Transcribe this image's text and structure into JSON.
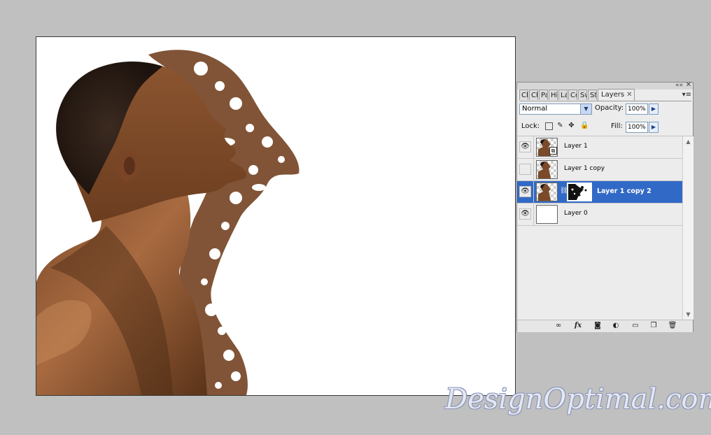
{
  "panel": {
    "tabs": [
      {
        "label": "Clo"
      },
      {
        "label": "Ch"
      },
      {
        "label": "Pa"
      },
      {
        "label": "His"
      },
      {
        "label": "La"
      },
      {
        "label": "Co"
      },
      {
        "label": "Sw"
      },
      {
        "label": "Sty"
      },
      {
        "label": "Layers",
        "active": true
      }
    ],
    "blend_mode": "Normal",
    "opacity_label": "Opacity:",
    "opacity_value": "100%",
    "lock_label": "Lock:",
    "fill_label": "Fill:",
    "fill_value": "100%",
    "layers": [
      {
        "name": "Layer 1",
        "visible": true,
        "selected": false,
        "smart_object": true,
        "mask": false
      },
      {
        "name": "Layer 1 copy",
        "visible": false,
        "selected": false,
        "smart_object": false,
        "mask": false
      },
      {
        "name": "Layer 1 copy 2",
        "visible": true,
        "selected": true,
        "smart_object": false,
        "mask": true
      },
      {
        "name": "Layer 0",
        "visible": true,
        "selected": false,
        "smart_object": false,
        "mask": false
      }
    ],
    "bottom_icons": [
      "link-layers-icon",
      "fx-icon",
      "add-mask-icon",
      "adjustment-layer-icon",
      "new-group-icon",
      "new-layer-icon",
      "trash-icon"
    ],
    "fx_label": "fx",
    "selected_color": "#3169c6"
  },
  "watermark": "DesignOptimal.com"
}
